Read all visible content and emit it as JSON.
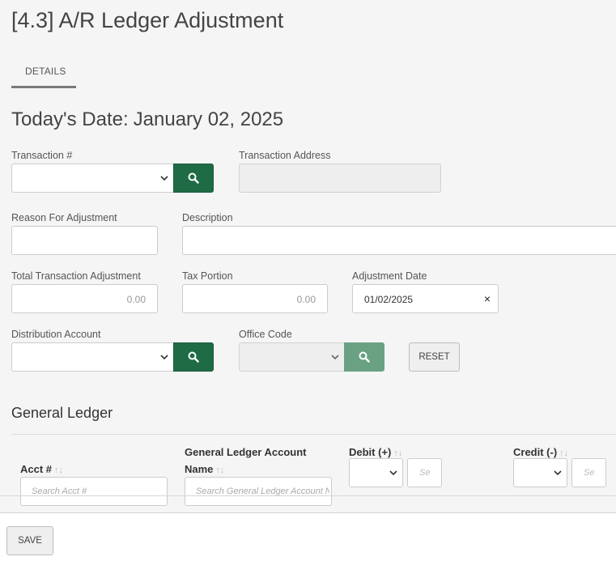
{
  "page": {
    "title": "[4.3] A/R Ledger Adjustment"
  },
  "tabs": [
    {
      "label": "DETAILS",
      "active": true
    }
  ],
  "today": {
    "label": "Today's Date:",
    "value": "January 02, 2025"
  },
  "form": {
    "transaction": {
      "label": "Transaction #",
      "value": ""
    },
    "transaction_address": {
      "label": "Transaction Address",
      "value": ""
    },
    "reason": {
      "label": "Reason For Adjustment",
      "value": ""
    },
    "description": {
      "label": "Description",
      "value": ""
    },
    "total_adjustment": {
      "label": "Total Transaction Adjustment",
      "value": "0.00"
    },
    "tax_portion": {
      "label": "Tax Portion",
      "value": "0.00"
    },
    "adjustment_date": {
      "label": "Adjustment Date",
      "value": "01/02/2025",
      "clear": "×"
    },
    "distribution_account": {
      "label": "Distribution Account",
      "value": ""
    },
    "office_code": {
      "label": "Office Code",
      "value": ""
    },
    "reset_label": "RESET"
  },
  "general_ledger": {
    "title": "General Ledger",
    "columns": [
      {
        "label": "Acct #",
        "sort": "↑↓",
        "filter_placeholder": "Search Acct #"
      },
      {
        "label": "General Ledger Account",
        "label2": "Name",
        "sort": "↑↓",
        "filter_placeholder": "Search General Ledger Account Name"
      },
      {
        "label": "Debit (+)",
        "sort": "↑↓",
        "filter_placeholder": "Se"
      },
      {
        "label": "Credit (-)",
        "sort": "↑↓",
        "filter_placeholder": "Se"
      }
    ]
  },
  "footer": {
    "save_label": "SAVE"
  },
  "colors": {
    "accent": "#1e6b45",
    "accent_disabled": "#6aa183",
    "background": "#f5f5f5"
  }
}
